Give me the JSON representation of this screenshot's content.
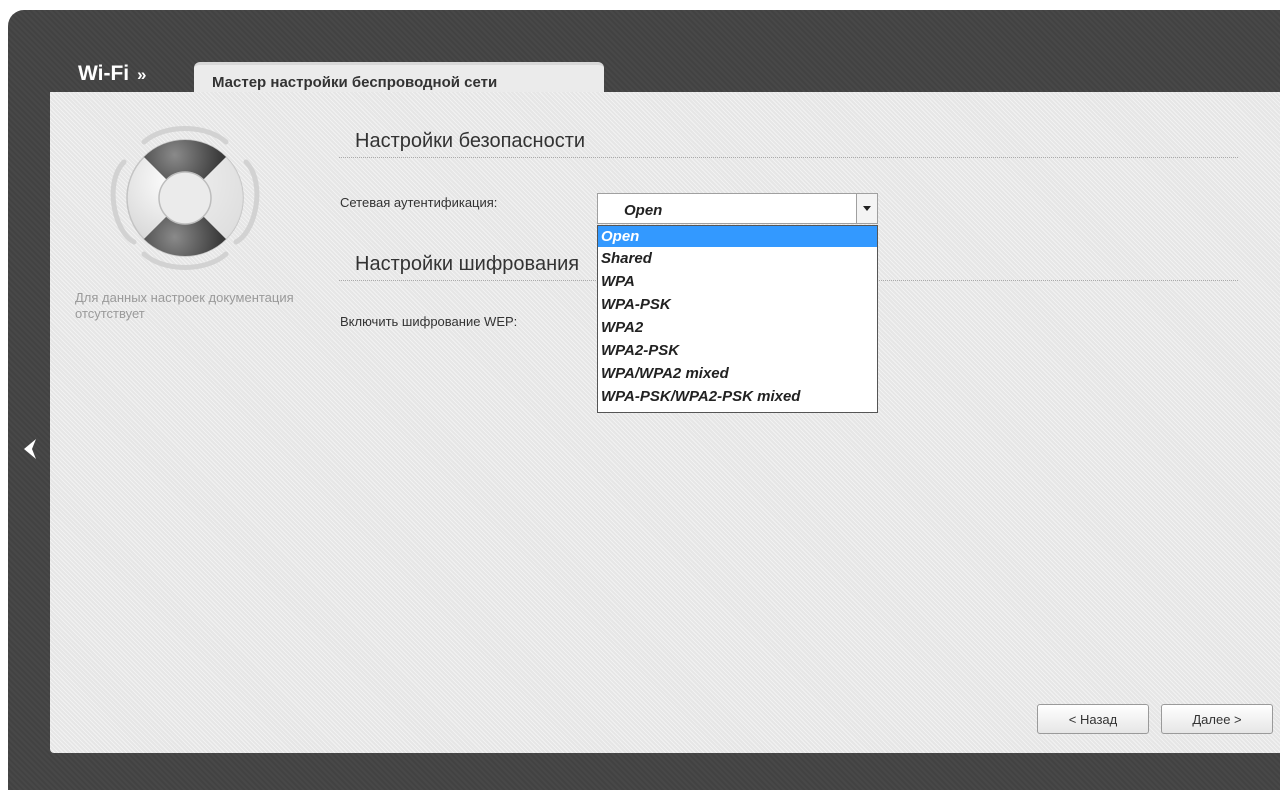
{
  "header": {
    "section": "Wi-Fi",
    "section_chevron": "»",
    "tab_label": "Мастер настройки беспроводной сети"
  },
  "sidebar": {
    "help_icon": "lifebuoy-icon",
    "help_text": "Для данных настроек документация отсутствует",
    "back_icon": "chevron-left-icon"
  },
  "security": {
    "title": "Настройки безопасности",
    "auth_label": "Сетевая аутентификация:",
    "auth_selected": "Open",
    "auth_options": [
      "Open",
      "Shared",
      "WPA",
      "WPA-PSK",
      "WPA2",
      "WPA2-PSK",
      "WPA/WPA2 mixed",
      "WPA-PSK/WPA2-PSK mixed"
    ]
  },
  "encryption": {
    "title": "Настройки шифрования",
    "wep_label": "Включить шифрование WEP:"
  },
  "footer": {
    "back_label": "< Назад",
    "next_label": "Далее >"
  },
  "colors": {
    "frame": "#444444",
    "content": "#ebebeb",
    "highlight": "#3399ff"
  }
}
